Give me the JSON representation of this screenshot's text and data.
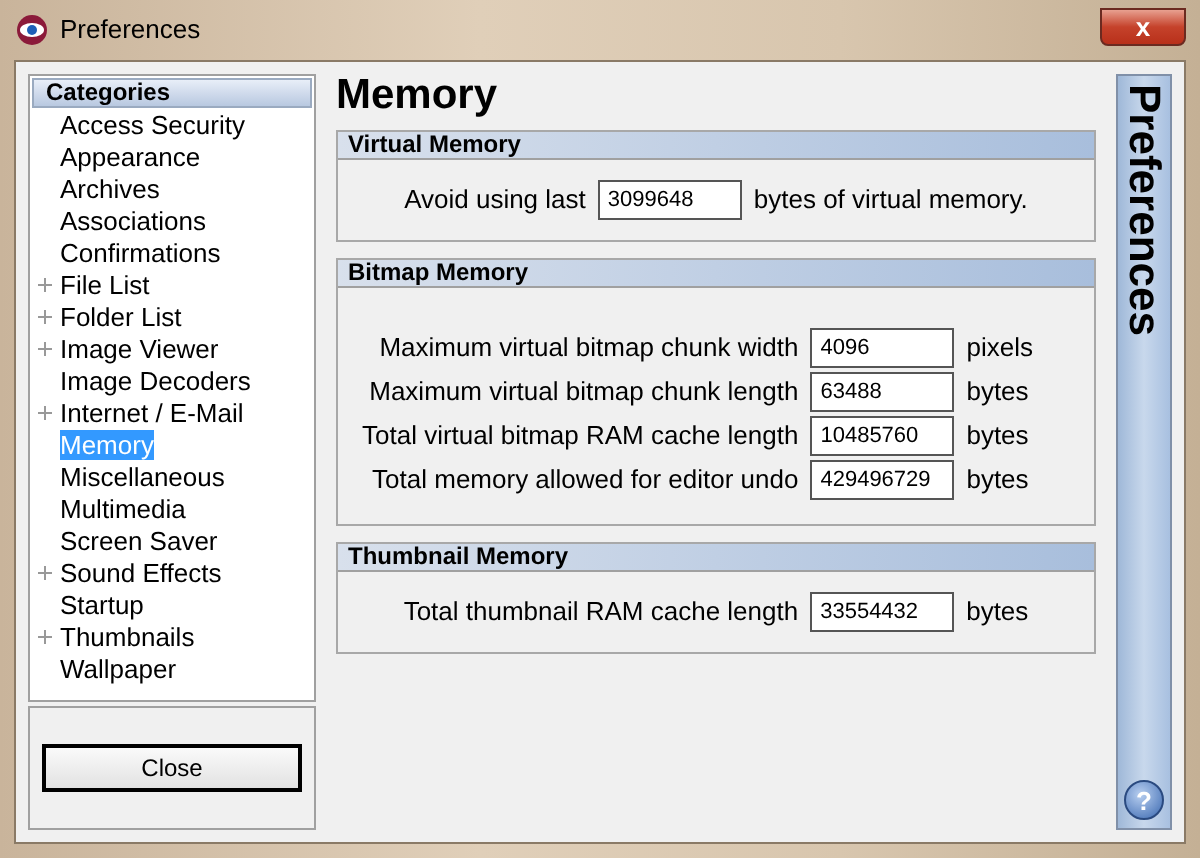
{
  "window": {
    "title": "Preferences",
    "close_symbol": "x"
  },
  "sidebar": {
    "heading": "Categories",
    "items": [
      {
        "label": "Access Security",
        "expandable": false,
        "selected": false
      },
      {
        "label": "Appearance",
        "expandable": false,
        "selected": false
      },
      {
        "label": "Archives",
        "expandable": false,
        "selected": false
      },
      {
        "label": "Associations",
        "expandable": false,
        "selected": false
      },
      {
        "label": "Confirmations",
        "expandable": false,
        "selected": false
      },
      {
        "label": "File List",
        "expandable": true,
        "selected": false
      },
      {
        "label": "Folder List",
        "expandable": true,
        "selected": false
      },
      {
        "label": "Image Viewer",
        "expandable": true,
        "selected": false
      },
      {
        "label": "Image Decoders",
        "expandable": false,
        "selected": false
      },
      {
        "label": "Internet / E-Mail",
        "expandable": true,
        "selected": false
      },
      {
        "label": "Memory",
        "expandable": false,
        "selected": true
      },
      {
        "label": "Miscellaneous",
        "expandable": false,
        "selected": false
      },
      {
        "label": "Multimedia",
        "expandable": false,
        "selected": false
      },
      {
        "label": "Screen Saver",
        "expandable": false,
        "selected": false
      },
      {
        "label": "Sound Effects",
        "expandable": true,
        "selected": false
      },
      {
        "label": "Startup",
        "expandable": false,
        "selected": false
      },
      {
        "label": "Thumbnails",
        "expandable": true,
        "selected": false
      },
      {
        "label": "Wallpaper",
        "expandable": false,
        "selected": false
      }
    ],
    "close_button": "Close"
  },
  "page_title": "Memory",
  "sections": [
    {
      "title": "Virtual Memory",
      "kind": "inline",
      "rows": [
        {
          "label": "Avoid using last",
          "value": "3099648",
          "unit": "bytes of virtual memory."
        }
      ]
    },
    {
      "title": "Bitmap Memory",
      "kind": "grid",
      "rows": [
        {
          "label": "Maximum virtual bitmap chunk width",
          "value": "4096",
          "unit": "pixels"
        },
        {
          "label": "Maximum virtual bitmap chunk length",
          "value": "63488",
          "unit": "bytes"
        },
        {
          "label": "Total virtual bitmap RAM cache length",
          "value": "10485760",
          "unit": "bytes"
        },
        {
          "label": "Total memory allowed for editor undo",
          "value": "429496729",
          "unit": "bytes"
        }
      ]
    },
    {
      "title": "Thumbnail Memory",
      "kind": "inline",
      "rows": [
        {
          "label": "Total thumbnail RAM cache length",
          "value": "33554432",
          "unit": "bytes"
        }
      ]
    }
  ],
  "banner": {
    "title": "Preferences",
    "help_symbol": "?"
  }
}
